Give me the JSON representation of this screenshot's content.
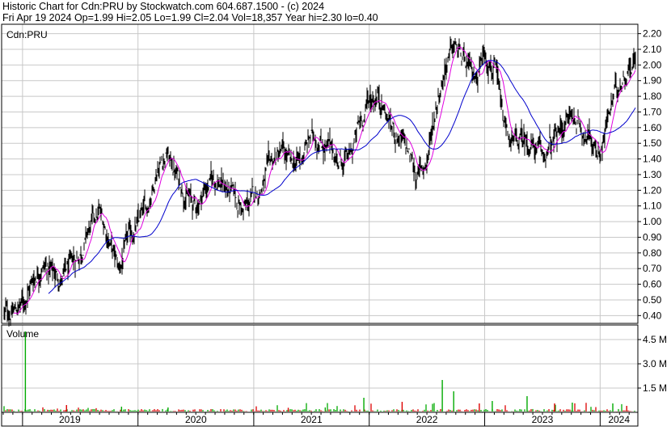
{
  "header": {
    "line1": "Historic Chart for Cdn:PRU by Stockwatch.com 604.687.1500 - (c) 2024",
    "line2": "Fri Apr 19 2024   Op=1.99  Hi=2.05  Lo=1.99  Cl=2.04  Vol=18,357  Year hi=2.30  lo=0.40"
  },
  "colors": {
    "price_bars": "#000000",
    "ma_short": "#e000e0",
    "ma_long": "#0000cc",
    "vol_up": "#00aa00",
    "vol_down": "#dd0000",
    "grid": "#c8c8c8"
  },
  "chart_data": [
    {
      "type": "line",
      "title": "Cdn:PRU",
      "ylim": [
        0.35,
        2.26
      ],
      "y_ticks": [
        "2.20",
        "2.10",
        "2.00",
        "1.90",
        "1.80",
        "1.70",
        "1.60",
        "1.50",
        "1.40",
        "1.30",
        "1.20",
        "1.10",
        "1.00",
        "0.90",
        "0.80",
        "0.70",
        "0.60",
        "0.50",
        "0.40"
      ],
      "x_tick_labels": [
        "2019",
        "2020",
        "2021",
        "2022",
        "2023",
        "2024"
      ],
      "x_range": [
        "2018-11-01",
        "2024-04-19"
      ],
      "grid": true,
      "series": [
        {
          "points": [
            [
              "2018-11-01",
              0.41
            ],
            [
              "2018-12-01",
              0.42
            ],
            [
              "2019-01-01",
              0.48
            ],
            [
              "2019-02-01",
              0.62
            ],
            [
              "2019-03-01",
              0.73
            ],
            [
              "2019-04-01",
              0.69
            ],
            [
              "2019-05-01",
              0.63
            ],
            [
              "2019-06-01",
              0.7
            ],
            [
              "2019-07-01",
              0.8
            ],
            [
              "2019-08-01",
              0.95
            ],
            [
              "2019-09-01",
              1.05
            ],
            [
              "2019-10-01",
              0.9
            ],
            [
              "2019-11-01",
              0.68
            ],
            [
              "2019-12-01",
              0.88
            ],
            [
              "2020-01-01",
              0.98
            ],
            [
              "2020-02-01",
              1.1
            ],
            [
              "2020-03-01",
              1.35
            ],
            [
              "2020-04-01",
              1.44
            ],
            [
              "2020-05-01",
              1.3
            ],
            [
              "2020-06-01",
              1.18
            ],
            [
              "2020-07-01",
              1.08
            ],
            [
              "2020-08-01",
              1.22
            ],
            [
              "2020-09-01",
              1.28
            ],
            [
              "2020-10-01",
              1.22
            ],
            [
              "2020-11-01",
              1.15
            ],
            [
              "2020-12-01",
              1.07
            ],
            [
              "2021-01-01",
              1.15
            ],
            [
              "2021-02-01",
              1.25
            ],
            [
              "2021-03-01",
              1.38
            ],
            [
              "2021-04-01",
              1.44
            ],
            [
              "2021-05-01",
              1.35
            ],
            [
              "2021-06-01",
              1.4
            ],
            [
              "2021-07-01",
              1.55
            ],
            [
              "2021-08-01",
              1.52
            ],
            [
              "2021-09-01",
              1.45
            ],
            [
              "2021-10-01",
              1.38
            ],
            [
              "2021-11-01",
              1.4
            ],
            [
              "2021-12-01",
              1.62
            ],
            [
              "2022-01-01",
              1.78
            ],
            [
              "2022-02-01",
              1.82
            ],
            [
              "2022-03-01",
              1.65
            ],
            [
              "2022-04-01",
              1.55
            ],
            [
              "2022-05-01",
              1.45
            ],
            [
              "2022-06-01",
              1.3
            ],
            [
              "2022-07-01",
              1.38
            ],
            [
              "2022-08-01",
              1.75
            ],
            [
              "2022-09-01",
              2.02
            ],
            [
              "2022-10-01",
              2.12
            ],
            [
              "2022-11-01",
              1.98
            ],
            [
              "2022-12-01",
              1.92
            ],
            [
              "2023-01-01",
              2.1
            ],
            [
              "2023-02-01",
              1.98
            ],
            [
              "2023-03-01",
              1.62
            ],
            [
              "2023-04-01",
              1.48
            ],
            [
              "2023-05-01",
              1.52
            ],
            [
              "2023-06-01",
              1.5
            ],
            [
              "2023-07-01",
              1.4
            ],
            [
              "2023-08-01",
              1.48
            ],
            [
              "2023-09-01",
              1.6
            ],
            [
              "2023-10-01",
              1.68
            ],
            [
              "2023-11-01",
              1.62
            ],
            [
              "2023-12-01",
              1.52
            ],
            [
              "2024-01-01",
              1.45
            ],
            [
              "2024-02-01",
              1.7
            ],
            [
              "2024-03-01",
              1.9
            ],
            [
              "2024-04-19",
              2.04
            ]
          ]
        }
      ]
    },
    {
      "type": "bar",
      "title": "Volume",
      "y_ticks": [
        "4.5 M",
        "3.0 M",
        "1.5 M"
      ],
      "ylim": [
        0,
        5.4
      ],
      "spikes": [
        [
          "2019-01-10",
          5.0
        ],
        [
          "2019-05-20",
          0.45
        ],
        [
          "2019-11-10",
          0.35
        ],
        [
          "2020-04-05",
          0.3
        ],
        [
          "2021-04-20",
          0.28
        ],
        [
          "2021-08-15",
          0.3
        ],
        [
          "2021-12-15",
          0.9
        ],
        [
          "2022-04-15",
          0.65
        ],
        [
          "2022-08-20",
          2.0
        ],
        [
          "2022-09-25",
          1.3
        ],
        [
          "2022-12-15",
          0.55
        ],
        [
          "2023-01-25",
          0.7
        ],
        [
          "2023-05-15",
          1.0
        ],
        [
          "2023-08-10",
          0.55
        ],
        [
          "2023-10-05",
          0.6
        ],
        [
          "2024-02-10",
          0.55
        ],
        [
          "2024-03-25",
          0.4
        ]
      ],
      "base_level": 0.12
    }
  ]
}
